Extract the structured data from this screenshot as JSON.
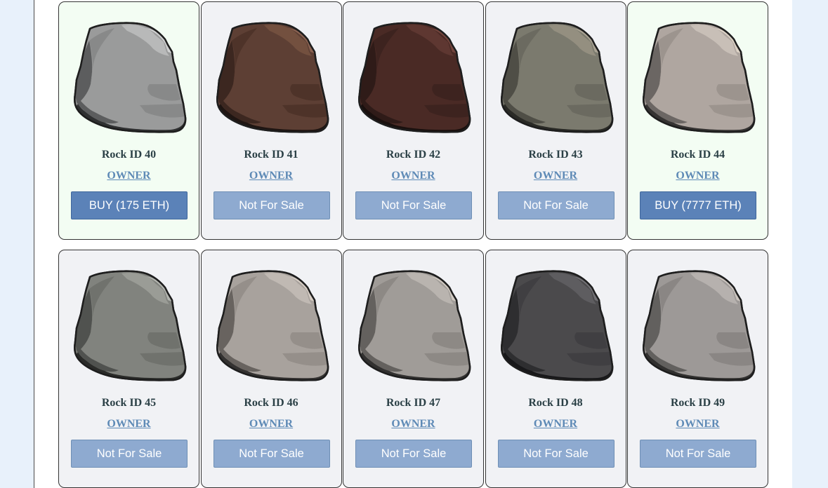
{
  "owner_label": "OWNER",
  "rocks": [
    {
      "id_label": "Rock ID 40",
      "button": "BUY (175 ETH)",
      "for_sale": true,
      "colors": {
        "base": "#9a9b9b",
        "light": "#b8b9b9",
        "dark": "#5c5d5e",
        "shadow": "#2f3031",
        "facet": "#888989",
        "highlight": "#cfd0d0"
      }
    },
    {
      "id_label": "Rock ID 41",
      "button": "Not For Sale",
      "for_sale": false,
      "colors": {
        "base": "#5d3f34",
        "light": "#73503f",
        "dark": "#3c2720",
        "shadow": "#1f1512",
        "facet": "#4e3329",
        "highlight": "#8a6251"
      }
    },
    {
      "id_label": "Rock ID 42",
      "button": "Not For Sale",
      "for_sale": false,
      "colors": {
        "base": "#4a2a25",
        "light": "#5e3731",
        "dark": "#2f1b18",
        "shadow": "#1a100e",
        "facet": "#3d231f",
        "highlight": "#73453d"
      }
    },
    {
      "id_label": "Rock ID 43",
      "button": "Not For Sale",
      "for_sale": false,
      "colors": {
        "base": "#7b7a6e",
        "light": "#948f80",
        "dark": "#4f4e46",
        "shadow": "#2a2a26",
        "facet": "#6b6a60",
        "highlight": "#aaa393"
      }
    },
    {
      "id_label": "Rock ID 44",
      "button": "BUY (7777 ETH)",
      "for_sale": true,
      "colors": {
        "base": "#afa6a0",
        "light": "#c8bfb7",
        "dark": "#6b6663",
        "shadow": "#353332",
        "facet": "#9c948e",
        "highlight": "#ddd3c6"
      }
    },
    {
      "id_label": "Rock ID 45",
      "button": "Not For Sale",
      "for_sale": false,
      "colors": {
        "base": "#81837e",
        "light": "#9a9c96",
        "dark": "#50524f",
        "shadow": "#2a2b29",
        "facet": "#70726d",
        "highlight": "#b4b6b0"
      }
    },
    {
      "id_label": "Rock ID 46",
      "button": "Not For Sale",
      "for_sale": false,
      "colors": {
        "base": "#a8a29d",
        "light": "#c0b9b3",
        "dark": "#68635f",
        "shadow": "#343231",
        "facet": "#958f8a",
        "highlight": "#d6cdc4"
      }
    },
    {
      "id_label": "Rock ID 47",
      "button": "Not For Sale",
      "for_sale": false,
      "colors": {
        "base": "#a09c98",
        "light": "#b9b4af",
        "dark": "#64615e",
        "shadow": "#323130",
        "facet": "#8d8985",
        "highlight": "#d0c9c1"
      }
    },
    {
      "id_label": "Rock ID 48",
      "button": "Not For Sale",
      "for_sale": false,
      "colors": {
        "base": "#4b4a4c",
        "light": "#5e5d60",
        "dark": "#2e2e30",
        "shadow": "#18181a",
        "facet": "#403f42",
        "highlight": "#727175"
      }
    },
    {
      "id_label": "Rock ID 49",
      "button": "Not For Sale",
      "for_sale": false,
      "colors": {
        "base": "#9d9997",
        "light": "#b6b1ae",
        "dark": "#62605e",
        "shadow": "#31302f",
        "facet": "#8a8684",
        "highlight": "#ccc5bf"
      }
    }
  ]
}
